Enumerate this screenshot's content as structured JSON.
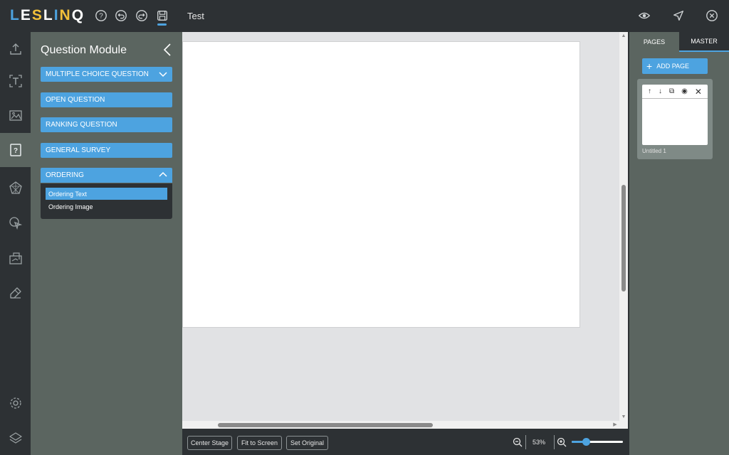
{
  "app": {
    "logo": "LESLINQ",
    "logo_colors": [
      "#4da3e0",
      "#ffffff",
      "#f2c13a",
      "#ffffff",
      "#4da3e0",
      "#f2c13a",
      "#ffffff"
    ],
    "doc_title": "Test"
  },
  "topbar": {
    "icons": [
      "help-icon",
      "undo-icon",
      "redo-icon",
      "save-icon",
      "preview-eye-icon",
      "send-icon",
      "close-circle-icon"
    ]
  },
  "rail": {
    "items": [
      "upload-icon",
      "text-icon",
      "media-icon",
      "question-icon",
      "assessment-icon",
      "interaction-icon",
      "import-icon",
      "eraser-icon",
      "settings-icon",
      "layers-icon"
    ],
    "active": "question-icon"
  },
  "question_panel": {
    "title": "Question Module",
    "buttons": [
      {
        "label": "MULTIPLE CHOICE QUESTION",
        "expandable": true
      },
      {
        "label": "OPEN QUESTION"
      },
      {
        "label": "RANKING QUESTION"
      },
      {
        "label": "GENERAL SURVEY"
      },
      {
        "label": "ORDERING",
        "expanded": true
      }
    ],
    "ordering_items": [
      "Ordering Text",
      "Ordering Image"
    ],
    "selected_item": "Ordering Text"
  },
  "bottombar": {
    "center_stage": "Center Stage",
    "fit_to_screen": "Fit to Screen",
    "set_original": "Set Original",
    "zoom": "53%",
    "zoom_level": 0.28
  },
  "right_panel": {
    "tabs": [
      "PAGES",
      "MASTER"
    ],
    "active_tab": "MASTER",
    "add_page": "ADD PAGE",
    "pages": [
      {
        "label": "Untitled 1"
      }
    ]
  },
  "colors": {
    "accent": "#4da3e0",
    "dark": "#2d3134",
    "panel": "#5b6560"
  }
}
